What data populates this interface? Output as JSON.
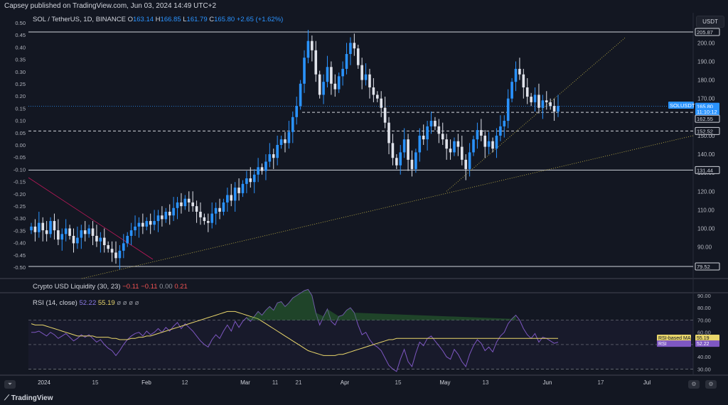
{
  "header": {
    "published": "Capsey published on TradingView.com, Jun 03, 2024 14:49 UTC+2"
  },
  "legend": {
    "symbol": "SOL / TetherUS, 1D, BINANCE",
    "o_label": "O",
    "o_val": "163.14",
    "h_label": "H",
    "h_val": "166.85",
    "l_label": "L",
    "l_val": "161.79",
    "c_label": "C",
    "c_val": "165.80",
    "change": "+2.65 (+1.62%)"
  },
  "currency_button": "USDT",
  "price_axis": {
    "ticks": [
      "200.00",
      "190.00",
      "180.00",
      "170.00",
      "160.00",
      "150.00",
      "140.00",
      "130.00",
      "120.00",
      "110.00",
      "100.00",
      "90.00"
    ],
    "labels": [
      {
        "text": "205.87",
        "bg": "#131722",
        "fg": "#d1d4dc",
        "border": "#d1d4dc"
      },
      {
        "text": "SOLUSDT",
        "bg": "#2a93ff",
        "fg": "#ffffff"
      },
      {
        "text": "165.80",
        "bg": "#2a93ff",
        "fg": "#ffffff"
      },
      {
        "text": "11:10:12",
        "bg": "#2a93ff",
        "fg": "#ffffff"
      },
      {
        "text": "162.55",
        "bg": "#131722",
        "fg": "#d1d4dc",
        "border": "#d1d4dc"
      },
      {
        "text": "152.52",
        "bg": "#131722",
        "fg": "#d1d4dc",
        "border": "#d1d4dc"
      },
      {
        "text": "131.44",
        "bg": "#131722",
        "fg": "#d1d4dc",
        "border": "#d1d4dc"
      },
      {
        "text": "79.52",
        "bg": "#131722",
        "fg": "#d1d4dc",
        "border": "#d1d4dc"
      }
    ]
  },
  "left_axis": {
    "ticks": [
      "0.50",
      "0.45",
      "0.40",
      "0.35",
      "0.30",
      "0.25",
      "0.20",
      "0.15",
      "0.10",
      "0.05",
      "0.00",
      "-0.05",
      "-0.10",
      "-0.15",
      "-0.20",
      "-0.25",
      "-0.30",
      "-0.35",
      "-0.40",
      "-0.45",
      "-0.50"
    ]
  },
  "liquidity_legend": {
    "name": "Crypto USD Liquidity (30, 23)",
    "v1": "−0.11",
    "v2": "−0.11",
    "v3": "0.00",
    "v4": "0.21"
  },
  "rsi_legend": {
    "name": "RSI (14, close)",
    "rsi": "52.22",
    "ma": "55.19",
    "rest": "ø  ø  ø  ø"
  },
  "rsi_axis": {
    "ticks": [
      "90.00",
      "80.00",
      "70.00",
      "60.00",
      "40.00",
      "30.00"
    ],
    "labels": [
      {
        "text": "RSI-based MA",
        "bg": "#e9d66b",
        "fg": "#131722"
      },
      {
        "text": "55.19",
        "bg": "#e9d66b",
        "fg": "#131722"
      },
      {
        "text": "RSI",
        "bg": "#7e57c2",
        "fg": "#ffffff"
      },
      {
        "text": "52.22",
        "bg": "#7e57c2",
        "fg": "#ffffff"
      }
    ]
  },
  "time_axis": [
    "2024",
    "15",
    "Feb",
    "12",
    "Mar",
    "11",
    "21",
    "Apr",
    "15",
    "May",
    "13",
    "Jun",
    "17",
    "Jul"
  ],
  "footer": {
    "brand": "TradingView"
  },
  "colors": {
    "up": "#2a93ff",
    "down": "#e0e3eb",
    "rsi": "#7e57c2",
    "rsi_ma": "#e9d66b"
  },
  "chart_data": [
    {
      "type": "candlestick",
      "title": "SOL / TetherUS, 1D, BINANCE",
      "ylim": [
        80,
        210
      ],
      "horizontal_levels": [
        205.87,
        162.55,
        152.52,
        131.44,
        79.52
      ],
      "last_price": 165.8,
      "closes": [
        101,
        98,
        103,
        99,
        97,
        104,
        99,
        94,
        97,
        100,
        96,
        92,
        95,
        99,
        97,
        100,
        96,
        93,
        95,
        91,
        89,
        87,
        84,
        88,
        92,
        96,
        99,
        101,
        103,
        101,
        104,
        102,
        104,
        107,
        105,
        109,
        107,
        111,
        114,
        112,
        116,
        114,
        112,
        109,
        106,
        104,
        103,
        108,
        111,
        109,
        114,
        118,
        115,
        122,
        119,
        124,
        127,
        125,
        129,
        133,
        131,
        136,
        140,
        138,
        145,
        148,
        146,
        152,
        160,
        166,
        178,
        192,
        201,
        196,
        183,
        172,
        179,
        187,
        178,
        175,
        182,
        186,
        194,
        200,
        197,
        188,
        180,
        183,
        176,
        172,
        170,
        165,
        157,
        146,
        138,
        134,
        141,
        148,
        137,
        132,
        141,
        150,
        148,
        155,
        158,
        155,
        151,
        148,
        143,
        141,
        147,
        144,
        137,
        132,
        141,
        148,
        153,
        150,
        144,
        147,
        143,
        150,
        155,
        158,
        170,
        179,
        186,
        183,
        176,
        171,
        168,
        172,
        165,
        169,
        168,
        166,
        163,
        166
      ],
      "rsi": [
        60,
        60,
        61,
        59,
        57,
        60,
        58,
        55,
        57,
        59,
        56,
        53,
        55,
        58,
        56,
        58,
        55,
        52,
        54,
        50,
        47,
        45,
        41,
        45,
        50,
        54,
        57,
        59,
        60,
        57,
        61,
        58,
        60,
        63,
        60,
        64,
        61,
        65,
        68,
        63,
        67,
        64,
        61,
        57,
        53,
        50,
        48,
        54,
        58,
        55,
        61,
        66,
        61,
        69,
        64,
        69,
        72,
        69,
        73,
        77,
        74,
        78,
        81,
        78,
        84,
        85,
        81,
        84,
        88,
        90,
        92,
        94,
        95,
        90,
        76,
        66,
        73,
        79,
        69,
        66,
        73,
        74,
        78,
        80,
        76,
        66,
        58,
        60,
        54,
        50,
        48,
        45,
        39,
        33,
        30,
        28,
        38,
        46,
        36,
        32,
        43,
        52,
        49,
        55,
        57,
        53,
        49,
        45,
        40,
        38,
        46,
        42,
        36,
        32,
        42,
        49,
        54,
        51,
        45,
        48,
        44,
        52,
        57,
        60,
        67,
        71,
        74,
        70,
        63,
        58,
        55,
        59,
        52,
        56,
        55,
        53,
        51,
        52
      ],
      "rsi_ma": [
        67,
        66,
        66,
        66,
        65,
        64,
        63,
        62,
        61,
        60,
        59,
        58,
        57,
        57,
        57,
        57,
        57,
        56,
        56,
        56,
        56,
        55,
        55,
        54,
        54,
        54,
        55,
        55,
        56,
        56,
        57,
        57,
        58,
        59,
        60,
        61,
        62,
        63,
        64,
        65,
        66,
        67,
        68,
        69,
        70,
        71,
        72,
        73,
        74,
        75,
        76,
        77,
        77,
        77,
        76,
        75,
        74,
        73,
        72,
        71,
        69,
        67,
        65,
        63,
        61,
        59,
        57,
        55,
        53,
        51,
        49,
        47,
        45,
        44,
        43,
        42,
        41,
        41,
        41,
        41,
        42,
        42,
        43,
        44,
        45,
        46,
        47,
        48,
        49,
        50,
        51,
        52,
        53,
        54,
        54,
        55,
        55,
        55,
        55,
        55,
        55,
        55,
        55,
        55,
        55,
        55,
        55,
        55,
        55,
        55,
        55,
        55,
        55,
        55,
        55,
        55,
        55,
        55,
        55,
        55,
        55,
        55,
        55,
        55,
        55,
        55,
        55,
        55,
        55,
        55,
        55,
        55,
        55,
        55,
        55,
        55,
        55,
        55
      ]
    }
  ]
}
